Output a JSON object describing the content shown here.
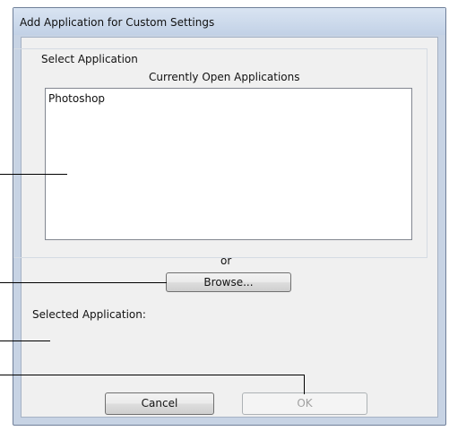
{
  "dialog": {
    "title": "Add Application for Custom Settings"
  },
  "select_group": {
    "label": "Select Application",
    "list_header": "Currently Open Applications",
    "items": [
      "Photoshop"
    ]
  },
  "separator_text": "or",
  "buttons": {
    "browse": "Browse...",
    "cancel": "Cancel",
    "ok": "OK"
  },
  "selected_label": "Selected Application:"
}
